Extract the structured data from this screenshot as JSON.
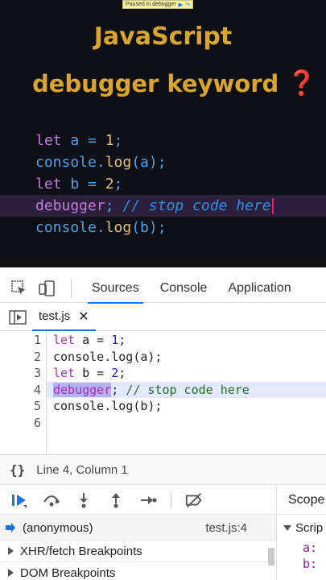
{
  "video": {
    "paused_label": "Paused in debugger",
    "title_line1": "JavaScript",
    "title_line2": "debugger keyword",
    "title_emoji": "❓",
    "code": [
      {
        "kw": "let",
        "rest": " a = ",
        "num": "1",
        "end": ";"
      },
      {
        "obj": "console",
        "dot": ".",
        "fn": "log",
        "args": "(a);"
      },
      {
        "kw": "let",
        "rest": " b = ",
        "num": "2",
        "end": ";"
      },
      {
        "kw": "debugger",
        "end": "; ",
        "comment": "// stop code here"
      },
      {
        "obj": "console",
        "dot": ".",
        "fn": "log",
        "args": "(b);"
      }
    ]
  },
  "devtools": {
    "tabs": [
      "Sources",
      "Console",
      "Application"
    ],
    "active_tab": "Sources",
    "file_tab": "test.js",
    "close_glyph": "✕",
    "line_numbers": [
      "1",
      "2",
      "3",
      "4",
      "5",
      "6"
    ],
    "status": {
      "braces": "{}",
      "position": "Line 4, Column 1"
    },
    "scope_tab": "Scope",
    "call_stack": {
      "fn": "(anonymous)",
      "loc": "test.js:4"
    },
    "sections": [
      "XHR/fetch Breakpoints",
      "DOM Breakpoints"
    ],
    "scope": {
      "header": "Scrip",
      "vars": [
        "a:",
        "b:"
      ]
    }
  },
  "colors": {
    "accent": "#1a73e8",
    "title_gold": "#d8a531",
    "keyword_dark": "#c678dd",
    "keyword_light": "#a62fb3"
  }
}
